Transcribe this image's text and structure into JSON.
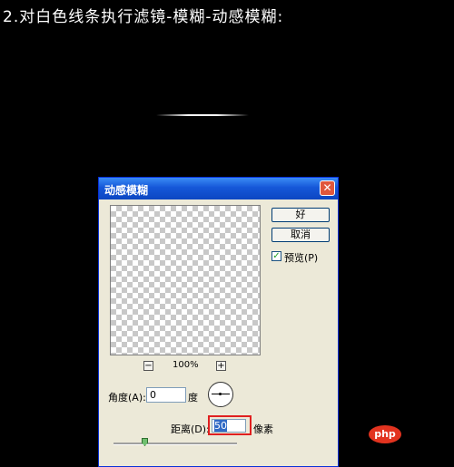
{
  "caption": "2.对白色线条执行滤镜-模糊-动感模糊:",
  "dialog": {
    "title": "动感模糊",
    "close_glyph": "✕",
    "ok_label": "好",
    "cancel_label": "取消",
    "preview_label": "预览(P)",
    "preview_checked": true,
    "zoom_minus": "−",
    "zoom_level": "100%",
    "zoom_plus": "+",
    "angle_label": "角度(A):",
    "angle_value": "0",
    "angle_unit": "度",
    "distance_label": "距离(D):",
    "distance_value": "50",
    "distance_unit": "像素",
    "checkbox_glyph": "✓"
  },
  "watermark": "php",
  "colors": {
    "background": "#000000",
    "titlebar": "#1557d8",
    "highlight_box": "#e02020",
    "watermark": "#e2331f"
  },
  "icons": [
    "close-icon",
    "zoom-out-icon",
    "zoom-in-icon",
    "angle-dial-icon",
    "checkbox-check-icon"
  ]
}
